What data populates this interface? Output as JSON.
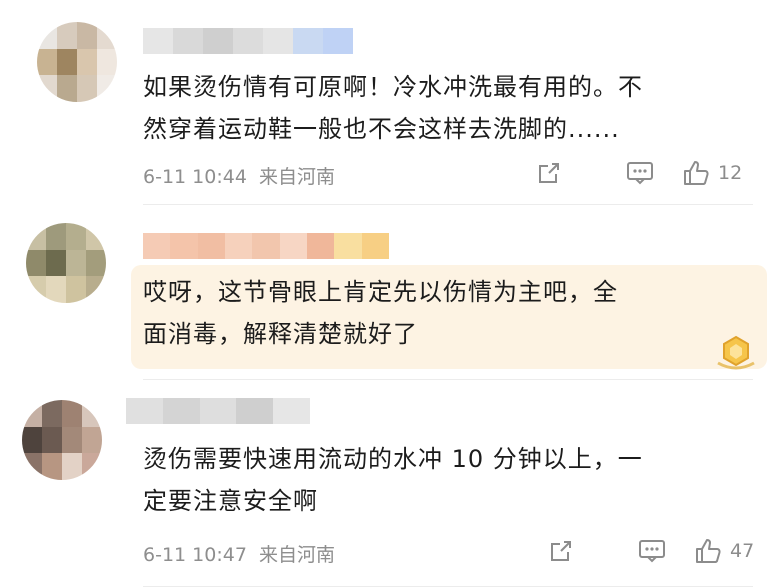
{
  "comments": [
    {
      "text_line1": "如果烫伤情有可原啊！冷水冲洗最有用的。不",
      "text_line2": "然穿着运动鞋一般也不会这样去洗脚的......",
      "time": "6-11 10:44",
      "location": "来自河南",
      "likes": "12",
      "avatar_colors": [
        "#e9e6e2",
        "#d7cbbd",
        "#c9b8a4",
        "#e4dad0",
        "#c8b392",
        "#9e8560",
        "#d9c6ad",
        "#efe7df",
        "#e2d9cf",
        "#b9a98f",
        "#d6c8b6",
        "#f0ebe6"
      ],
      "name_colors": [
        "#e6e6e6",
        "#d9d9d9",
        "#cfcfcf",
        "#dcdcdc",
        "#e5e5e5",
        "#c9d9f2",
        "#bfd2f5"
      ],
      "icons": [
        "share-icon",
        "comment-icon",
        "like-icon"
      ]
    },
    {
      "text_line1": "哎呀，这节骨眼上肯定先以伤情为主吧，全",
      "text_line2": "面消毒，解释清楚就好了",
      "avatar_colors": [
        "#c7bfa3",
        "#9e9a7c",
        "#b4ae8e",
        "#d0c6a8",
        "#8f8a6a",
        "#6d6b4e",
        "#bcb596",
        "#a39d7c",
        "#d6ccac",
        "#e3d8bc",
        "#cfc39f",
        "#b8ad8d"
      ],
      "name_colors": [
        "#f5cbb5",
        "#f4c4aa",
        "#f1bea3",
        "#f6d1bc",
        "#f2c6ad",
        "#f7d6c4",
        "#f0b79a",
        "#f9dfa0",
        "#f7cf84"
      ],
      "icons": [
        "badge-icon"
      ]
    },
    {
      "text_line1": "烫伤需要快速用流动的水冲 10 分钟以上，一",
      "text_line2": "定要注意安全啊",
      "time": "6-11 10:47",
      "location": "来自河南",
      "likes": "47",
      "avatar_colors": [
        "#c5b0a4",
        "#7c6a60",
        "#9e8272",
        "#d7c6bb",
        "#4e433d",
        "#6b5a51",
        "#a38979",
        "#c1a594",
        "#8a7368",
        "#b79682",
        "#e3d2c6",
        "#caa89a"
      ],
      "name_colors": [
        "#e0e0e0",
        "#d4d4d4",
        "#dedede",
        "#cfcfcf",
        "#e6e6e6"
      ],
      "icons": [
        "share-icon",
        "comment-icon",
        "like-icon"
      ]
    }
  ],
  "colors": {
    "text": "#1c1c1c",
    "meta": "#8e8e8e",
    "highlight": "#fdf3e3",
    "divider": "#ececec"
  }
}
